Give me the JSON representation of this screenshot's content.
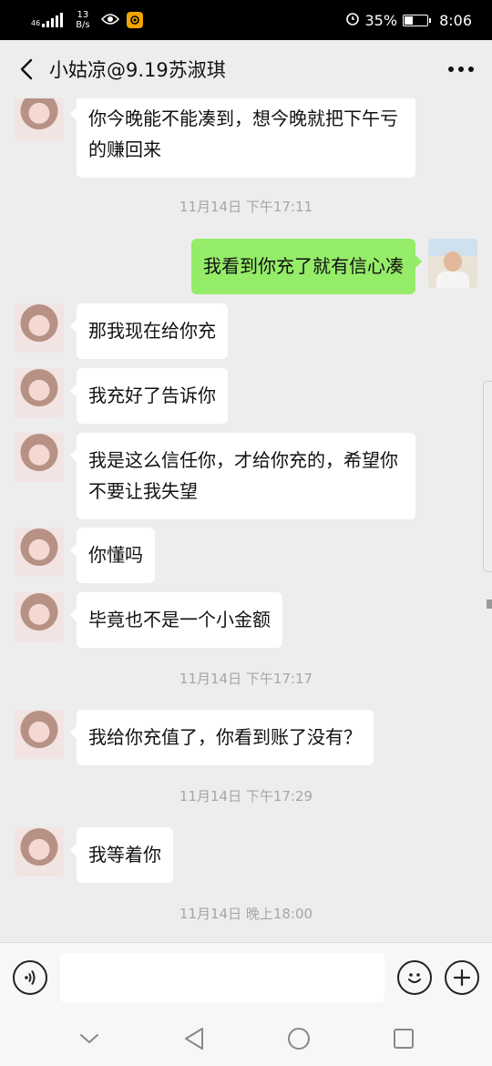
{
  "status_bar": {
    "network_type": "46",
    "net_speed_value": "13",
    "net_speed_unit": "B/s",
    "battery_percent": "35%",
    "battery_level": 0.35,
    "time": "8:06",
    "icons": [
      "signal-icon",
      "eye-icon",
      "app-notification-icon",
      "alarm-icon",
      "battery-icon"
    ]
  },
  "header": {
    "title": "小姑凉@9.19苏淑琪",
    "back_icon": "back-arrow-icon",
    "more_icon": "more-dots-icon"
  },
  "messages": [
    {
      "side": "left",
      "text": "你今晚能不能凑到，想今晚就把下午亏的赚回来"
    },
    {
      "type": "time",
      "text": "11月14日 下午17:11"
    },
    {
      "side": "right",
      "text": "我看到你充了就有信心凑"
    },
    {
      "side": "left",
      "text": "那我现在给你充"
    },
    {
      "side": "left",
      "text": "我充好了告诉你"
    },
    {
      "side": "left",
      "text": "我是这么信任你，才给你充的，希望你不要让我失望"
    },
    {
      "side": "left",
      "text": "你懂吗"
    },
    {
      "side": "left",
      "text": "毕竟也不是一个小金额"
    },
    {
      "type": "time",
      "text": "11月14日 下午17:17"
    },
    {
      "side": "left",
      "text": "我给你充值了，你看到账了没有？"
    },
    {
      "type": "time",
      "text": "11月14日 下午17:29"
    },
    {
      "side": "left",
      "text": "我等着你"
    },
    {
      "type": "time",
      "text": "11月14日 晚上18:00"
    }
  ],
  "input_bar": {
    "value": "",
    "placeholder": ""
  },
  "colors": {
    "background": "#ededed",
    "sent_bubble": "#95ec69",
    "received_bubble": "#ffffff",
    "timestamp": "#a6a6a6"
  }
}
